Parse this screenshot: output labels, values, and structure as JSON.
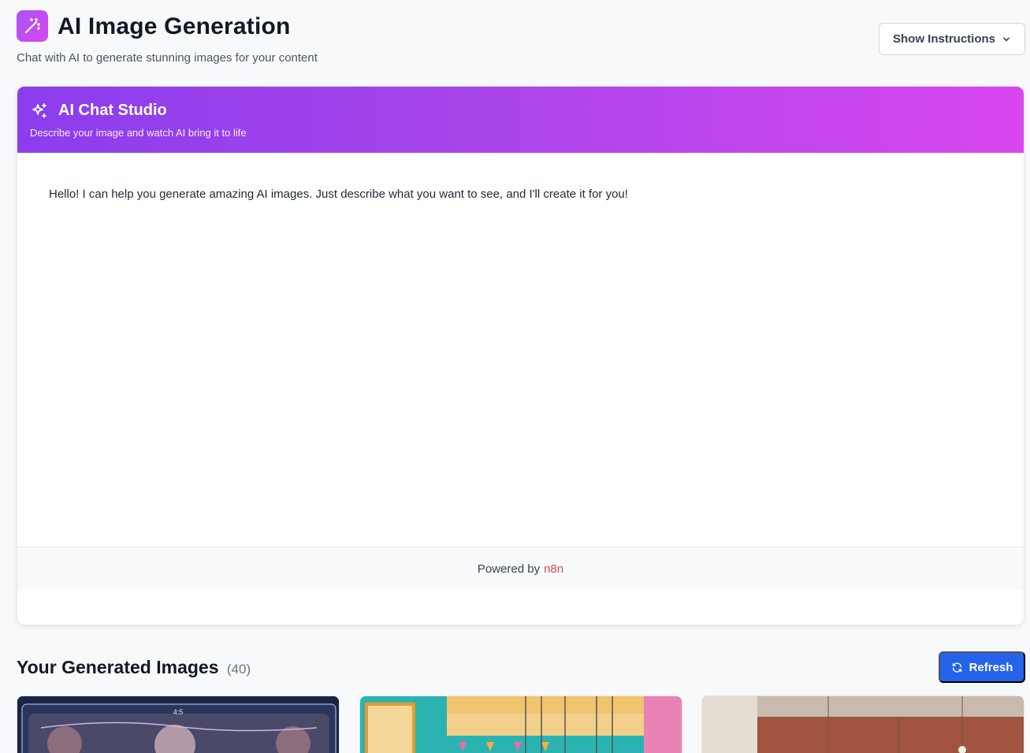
{
  "header": {
    "title": "AI Image Generation",
    "subtitle": "Chat with AI to generate stunning images for your content",
    "logo_icon": "magic-wand-icon",
    "instructions_button": "Show Instructions"
  },
  "chat": {
    "title": "AI Chat Studio",
    "subtitle": "Describe your image and watch AI bring it to life",
    "header_icon": "sparkles-icon",
    "messages": [
      {
        "role": "assistant",
        "text": "Hello! I can help you generate amazing AI images. Just describe what you want to see, and I'll create it for you!"
      }
    ],
    "footer_prefix": "Powered by",
    "footer_link": "n8n"
  },
  "gallery": {
    "title": "Your Generated Images",
    "count": "(40)",
    "refresh_label": "Refresh",
    "refresh_icon": "refresh-icon",
    "items": [
      {
        "label": "4:5"
      },
      {
        "label": ""
      },
      {
        "label": ""
      }
    ]
  },
  "colors": {
    "accent_purple": "#8b3ded",
    "accent_pink": "#d946ef",
    "primary_blue": "#2563eb",
    "n8n_link": "#cf4f5b"
  }
}
